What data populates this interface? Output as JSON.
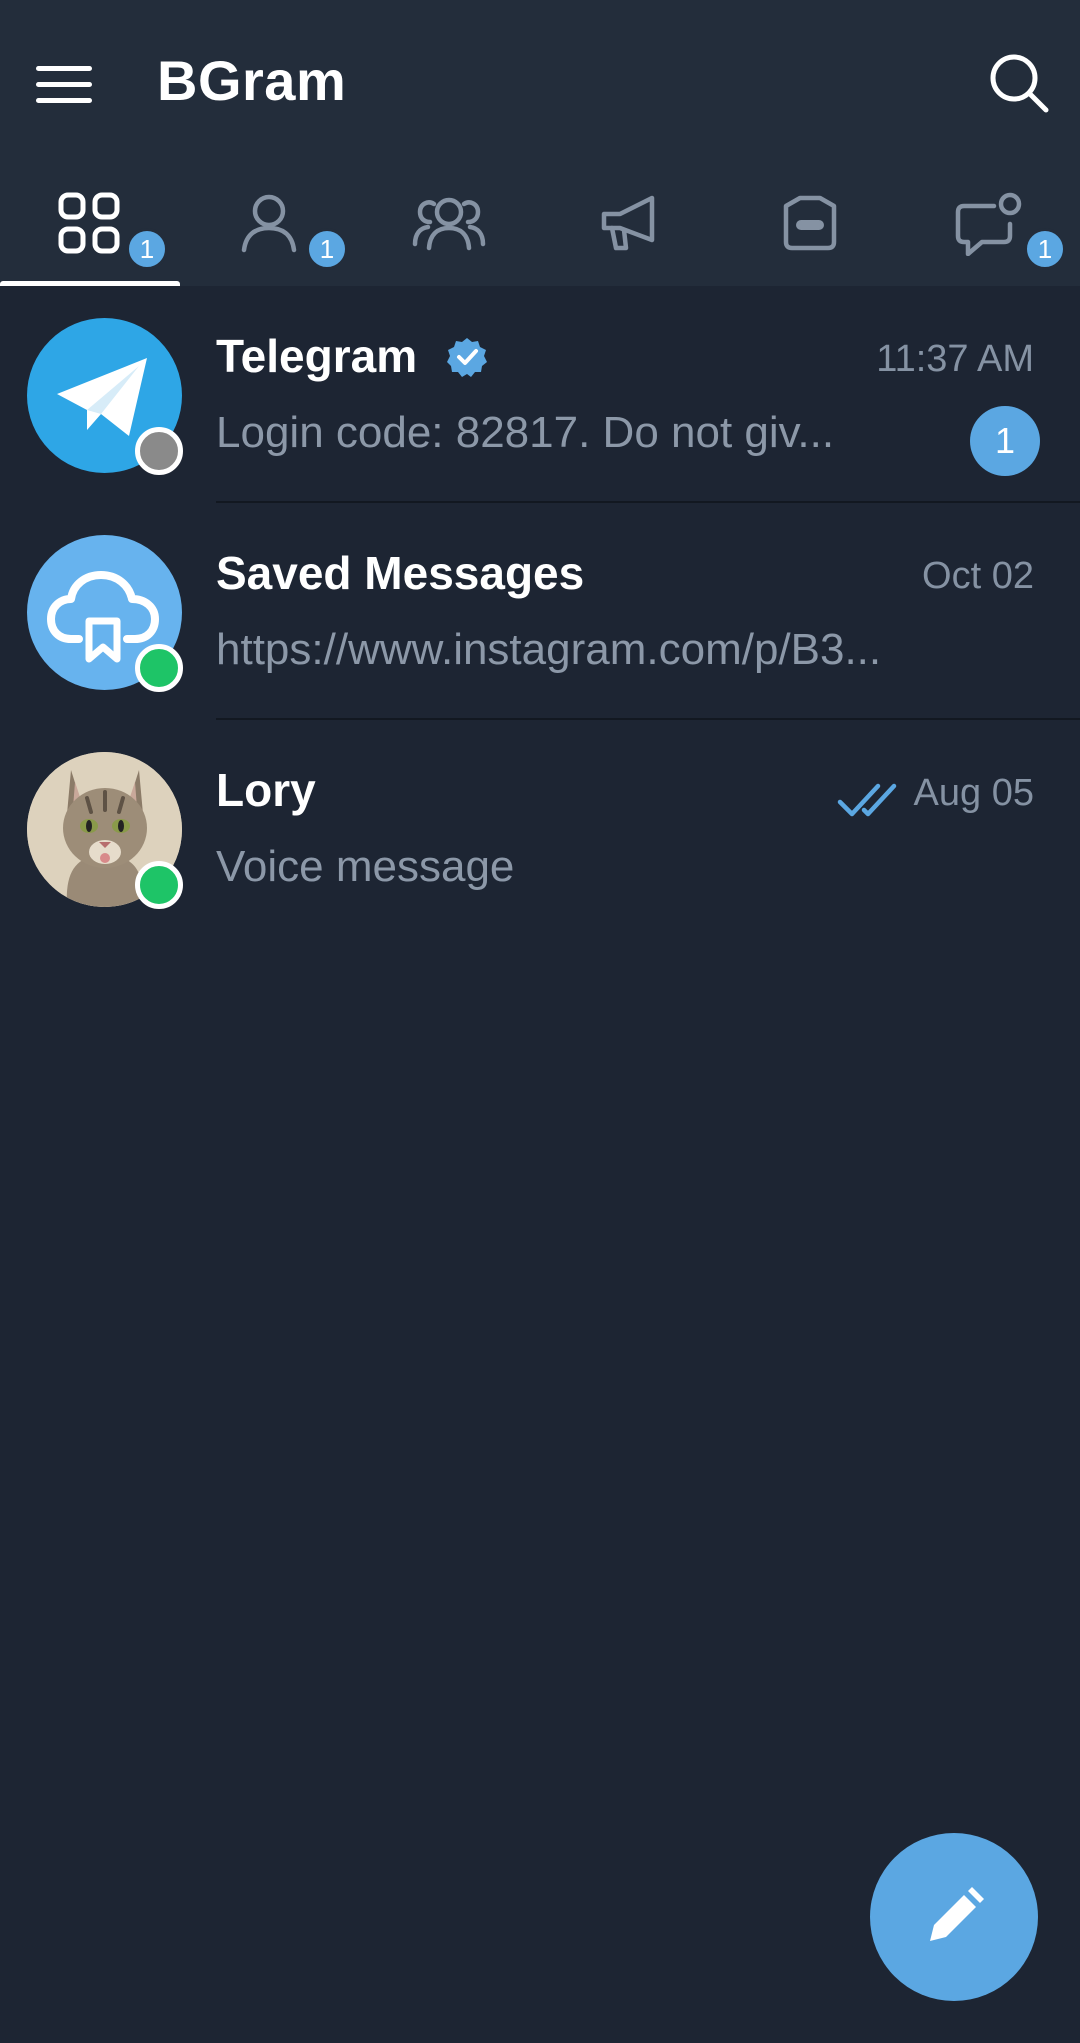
{
  "app": {
    "title": "BGram"
  },
  "colors": {
    "background": "#1d2533",
    "header": "#232d3b",
    "accent": "#5ba7e2",
    "online": "#1ec467",
    "offline": "#8a8a8a",
    "text_primary": "#ffffff",
    "text_secondary": "#8c98a8"
  },
  "tabs": [
    {
      "name": "all-chats",
      "icon": "grid-icon",
      "badge": "1",
      "active": true
    },
    {
      "name": "contacts",
      "icon": "person-icon",
      "badge": "1",
      "active": false
    },
    {
      "name": "groups",
      "icon": "group-icon",
      "badge": "",
      "active": false
    },
    {
      "name": "channels",
      "icon": "megaphone-icon",
      "badge": "",
      "active": false
    },
    {
      "name": "bots",
      "icon": "bot-icon",
      "badge": "",
      "active": false
    },
    {
      "name": "unread",
      "icon": "chat-bubble-icon",
      "badge": "1",
      "active": false
    }
  ],
  "chats": [
    {
      "name": "Telegram",
      "verified": true,
      "time": "11:37 AM",
      "preview": "Login code: 82817. Do not giv...",
      "unread": "1",
      "status": "offline",
      "avatar": "telegram-logo"
    },
    {
      "name": "Saved Messages",
      "verified": false,
      "time": "Oct 02",
      "preview": "https://www.instagram.com/p/B3...",
      "unread": "",
      "status": "online",
      "avatar": "saved-cloud"
    },
    {
      "name": "Lory",
      "verified": false,
      "time": "Aug 05",
      "preview": "Voice message",
      "unread": "",
      "read_receipt": "double-check-icon",
      "status": "online",
      "avatar": "cat-photo"
    }
  ],
  "fab": {
    "icon": "pencil-icon"
  }
}
